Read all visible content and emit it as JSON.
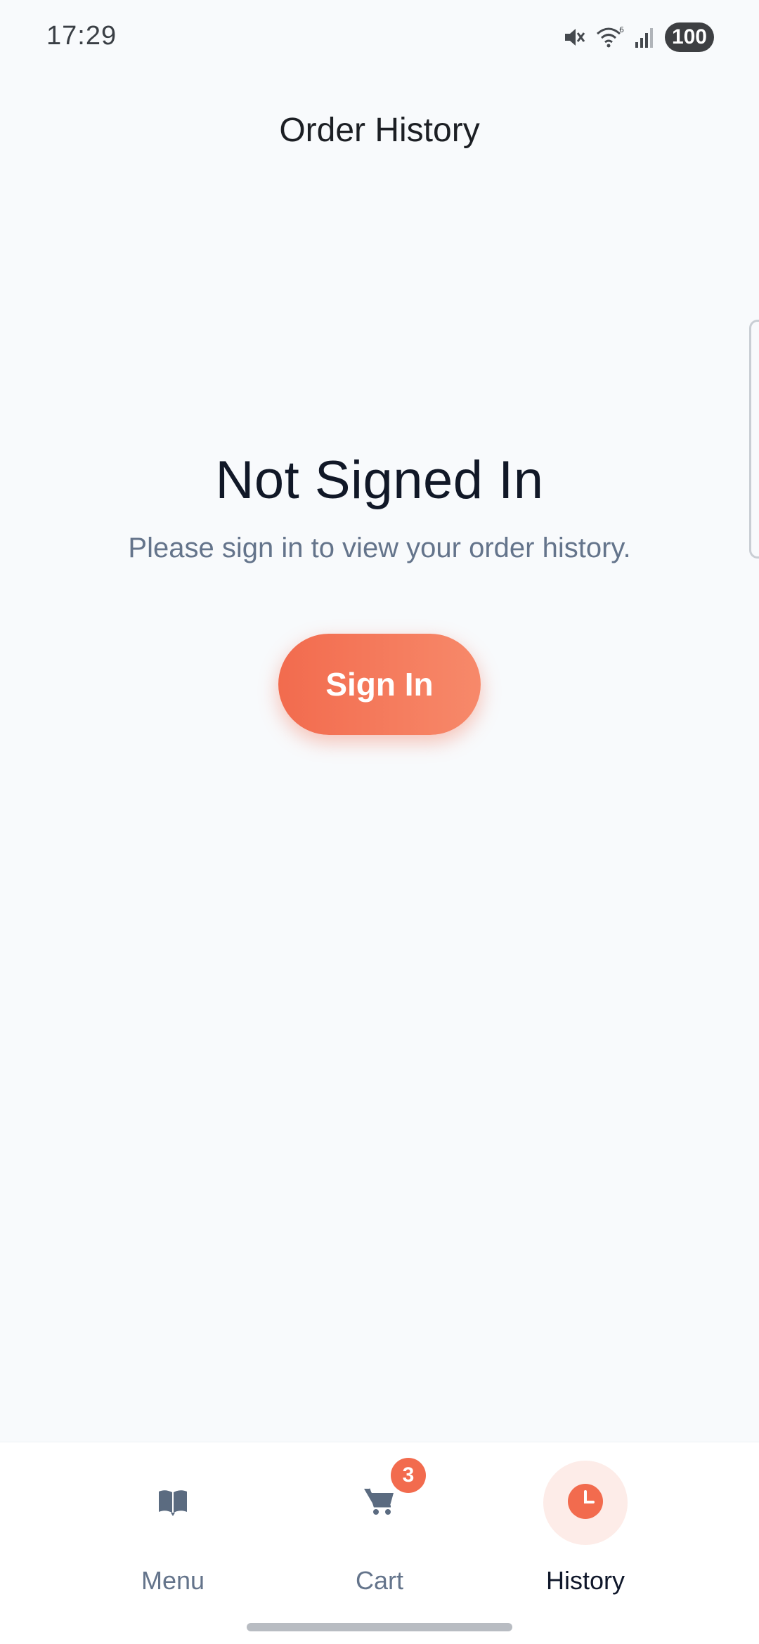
{
  "status_bar": {
    "time": "17:29",
    "battery": "100",
    "icons": [
      "mute-icon",
      "wifi-icon",
      "signal-icon",
      "battery-icon"
    ]
  },
  "header": {
    "title": "Order History"
  },
  "empty_state": {
    "title": "Not Signed In",
    "description": "Please sign in to view your order history.",
    "button_label": "Sign In"
  },
  "bottom_nav": {
    "items": [
      {
        "label": "Menu",
        "icon": "book-icon",
        "active": false
      },
      {
        "label": "Cart",
        "icon": "cart-icon",
        "active": false,
        "badge": "3"
      },
      {
        "label": "History",
        "icon": "clock-icon",
        "active": true
      }
    ]
  },
  "colors": {
    "accent": "#f26b4e",
    "background": "#f8fafc",
    "muted_text": "#64748b",
    "active_bg": "#fdece8"
  }
}
